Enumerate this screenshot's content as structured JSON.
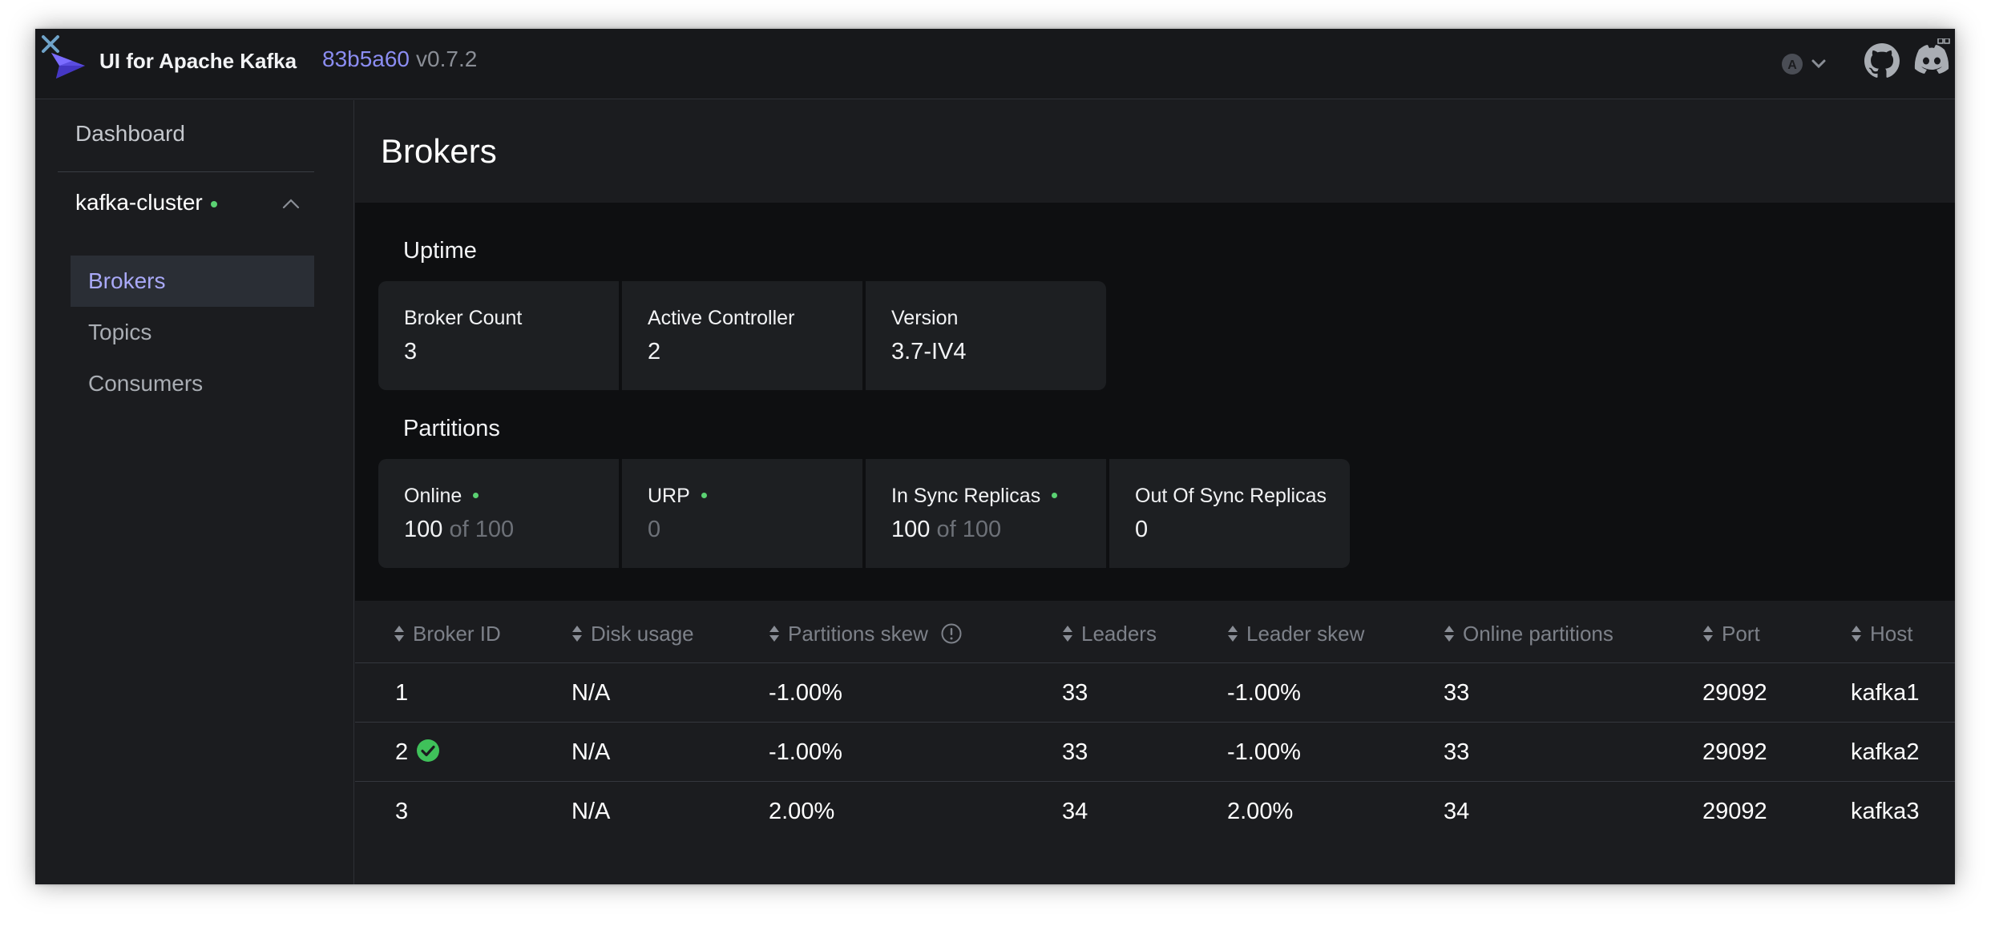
{
  "app": {
    "title": "UI for Apache Kafka",
    "commit_hash": "83b5a60",
    "version": "v0.7.2"
  },
  "topbar": {
    "user_menu_icon": "user-avatar-icon",
    "github_icon": "github-icon",
    "discord_icon": "discord-icon"
  },
  "sidebar": {
    "dashboard_label": "Dashboard",
    "cluster": {
      "name": "kafka-cluster",
      "status_color": "#5ad172",
      "items": [
        {
          "label": "Brokers",
          "active": true
        },
        {
          "label": "Topics",
          "active": false
        },
        {
          "label": "Consumers",
          "active": false
        }
      ]
    }
  },
  "page": {
    "title": "Brokers"
  },
  "uptime": {
    "title": "Uptime",
    "cards": [
      {
        "label": "Broker Count",
        "value": "3"
      },
      {
        "label": "Active Controller",
        "value": "2"
      },
      {
        "label": "Version",
        "value": "3.7-IV4"
      }
    ]
  },
  "partitions": {
    "title": "Partitions",
    "cards": [
      {
        "label": "Online",
        "value": "100",
        "suffix": "of 100"
      },
      {
        "label": "URP",
        "value": "0"
      },
      {
        "label": "In Sync Replicas",
        "value": "100",
        "suffix": "of 100"
      },
      {
        "label": "Out Of Sync Replicas",
        "value": "0"
      }
    ]
  },
  "table": {
    "columns": [
      "Broker ID",
      "Disk usage",
      "Partitions skew",
      "Leaders",
      "Leader skew",
      "Online partitions",
      "Port",
      "Host"
    ],
    "rows": [
      {
        "broker_id": "1",
        "controller": false,
        "disk_usage": "N/A",
        "partitions_skew": "-1.00%",
        "leaders": "33",
        "leader_skew": "-1.00%",
        "online_partitions": "33",
        "port": "29092",
        "host": "kafka1"
      },
      {
        "broker_id": "2",
        "controller": true,
        "disk_usage": "N/A",
        "partitions_skew": "-1.00%",
        "leaders": "33",
        "leader_skew": "-1.00%",
        "online_partitions": "33",
        "port": "29092",
        "host": "kafka2"
      },
      {
        "broker_id": "3",
        "controller": false,
        "disk_usage": "N/A",
        "partitions_skew": "2.00%",
        "leaders": "34",
        "leader_skew": "2.00%",
        "online_partitions": "34",
        "port": "29092",
        "host": "kafka3"
      }
    ]
  },
  "colors": {
    "accent": "#8b8df2",
    "success": "#5ad172",
    "background": "#1b1c1f"
  }
}
